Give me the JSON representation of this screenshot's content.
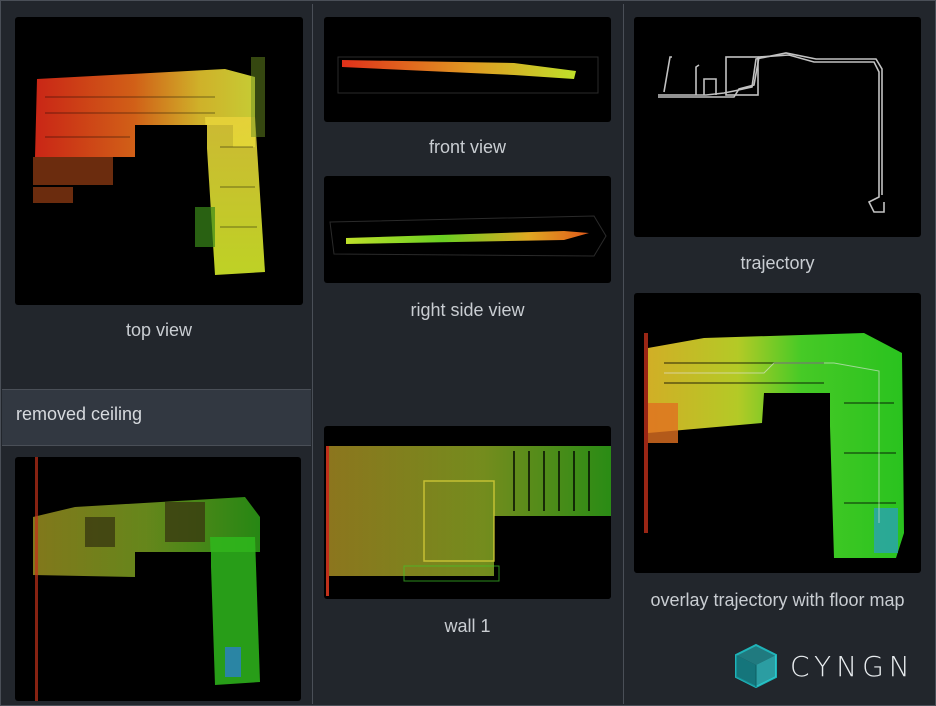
{
  "captions": {
    "top_view": "top view",
    "front_view": "front view",
    "right_side_view": "right side view",
    "trajectory": "trajectory",
    "wall_1": "wall 1",
    "overlay": "overlay trajectory with floor map"
  },
  "section": {
    "removed_ceiling": "removed ceiling"
  },
  "brand": {
    "name": "CYNGN",
    "logo_icon": "cube-gem-logo-icon",
    "accent": "#1fb3b8"
  },
  "colors": {
    "background": "#22262c",
    "panel": "#000000",
    "divider": "#4a4f57",
    "red": "#e8311b",
    "yellow": "#e8e23a",
    "green": "#3ee02a"
  }
}
